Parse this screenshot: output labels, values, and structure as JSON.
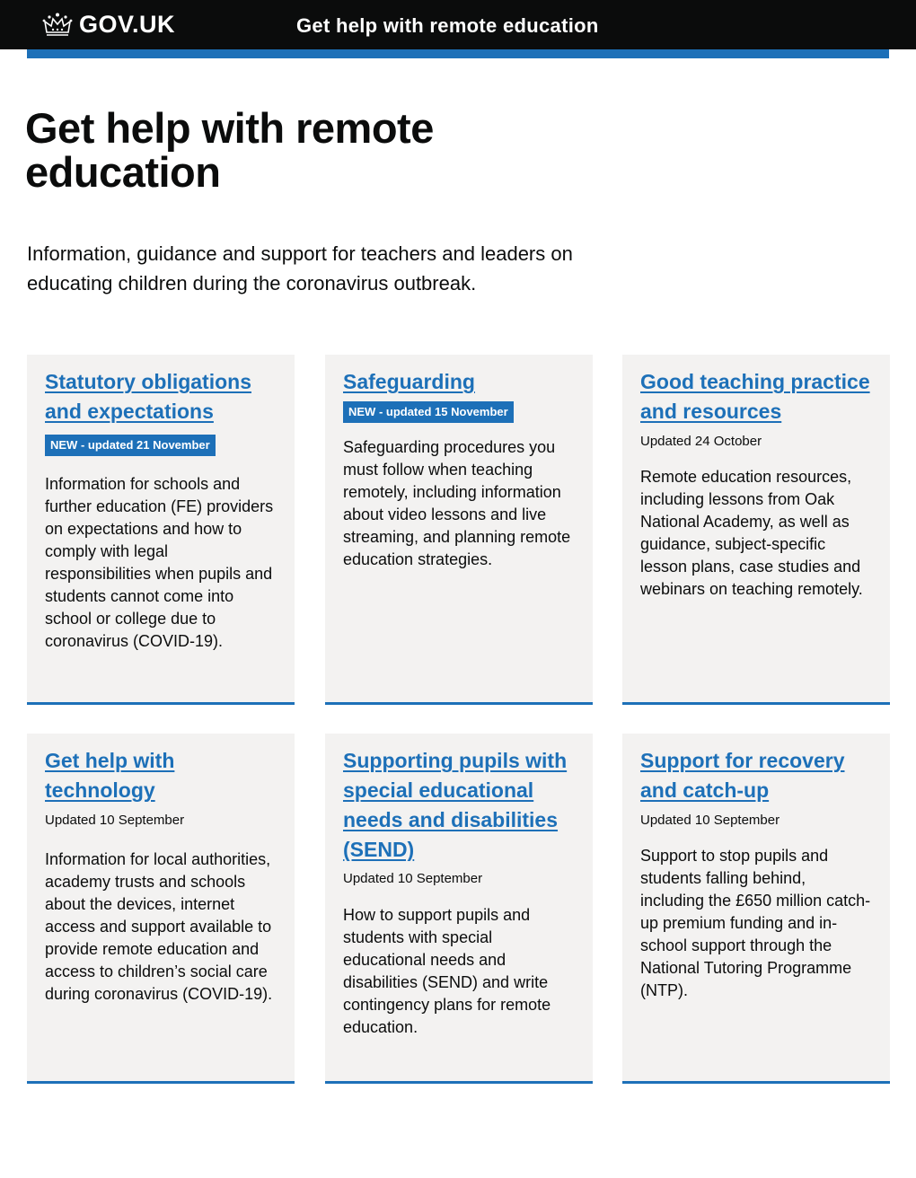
{
  "header": {
    "logo_text": "GOV.UK",
    "service_name": "Get help with remote education",
    "logo_icon": "crown-icon"
  },
  "page": {
    "title": "Get help with remote education",
    "lead": "Information, guidance and support for teachers and leaders on educating children during the coronavirus outbreak."
  },
  "colors": {
    "header_bg": "#0b0c0c",
    "brand_blue": "#1d70b8",
    "card_bg": "#f3f2f1",
    "text": "#0b0c0c"
  },
  "cards": [
    {
      "title": "Statutory obligations and expectations",
      "tag": "NEW - updated 21 November",
      "updated": "",
      "description": "Information for schools and further education (FE) providers on expectations and how to comply with legal responsibilities when pupils and students cannot come into school or college due to coronavirus (COVID-19)."
    },
    {
      "title": "Safeguarding",
      "tag": "NEW - updated 15 November",
      "updated": "",
      "description": "Safeguarding procedures you must follow when teaching remotely, including information about video lessons and live streaming, and planning remote education strategies."
    },
    {
      "title": "Good teaching practice and resources",
      "tag": "",
      "updated": "Updated 24 October",
      "description": "Remote education resources, including lessons from Oak National Academy, as well as guidance, subject-specific lesson plans, case studies and webinars on teaching remotely."
    },
    {
      "title": "Get help with technology",
      "tag": "",
      "updated": "Updated 10 September",
      "description": "Information for local authorities, academy trusts and schools about the devices, internet access and support available to provide remote education and access to children’s social care during coronavirus (COVID-19)."
    },
    {
      "title": "Supporting pupils with special educational needs and disabilities (SEND)",
      "tag": "",
      "updated": "Updated 10 September",
      "description": "How to support pupils and students with special educational needs and disabilities (SEND) and write contingency plans for remote education."
    },
    {
      "title": "Support for recovery and catch-up",
      "tag": "",
      "updated": "Updated 10 September",
      "description": "Support to stop pupils and students falling behind, including the £650 million catch-up premium funding and in-school support through the National Tutoring Programme (NTP)."
    }
  ]
}
